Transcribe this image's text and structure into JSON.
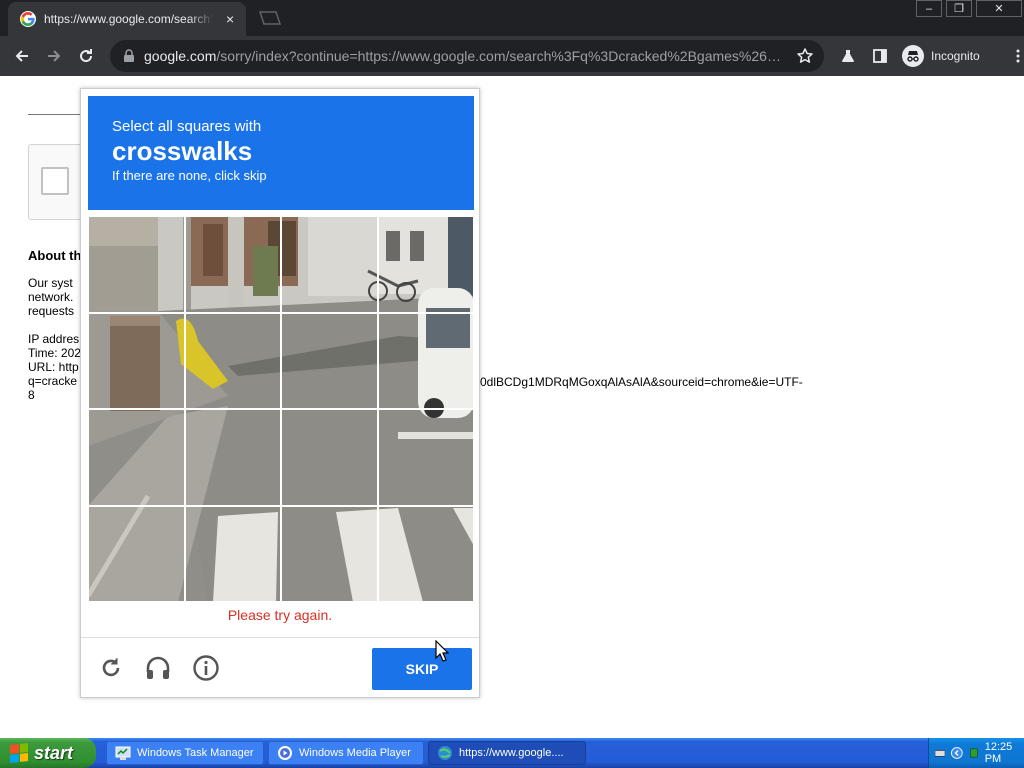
{
  "browser": {
    "tab_title": "https://www.google.com/search?q=",
    "tab_close": "×",
    "url_host": "google.com",
    "url_path": "/sorry/index?continue=https://www.google.com/search%3Fq%3Dcracked%2Bgames%26…",
    "profile_label": "Incognito",
    "window_controls": {
      "minimize": "–",
      "restore": "❐",
      "close": "✕"
    }
  },
  "page": {
    "about_heading": "About th",
    "text_lines": [
      "Our syst",
      "network.",
      "requests",
      "",
      "IP addres",
      "Time: 202",
      "URL: http",
      "q=cracke",
      "8"
    ],
    "right_fragment": "0dlBCDg1MDRqMGoxqAlAsAlA&sourceid=chrome&ie=UTF-"
  },
  "captcha": {
    "instruction": "Select all squares with",
    "target": "crosswalks",
    "hint": "If there are none, click skip",
    "error": "Please try again.",
    "skip_label": "SKIP",
    "icons": [
      "reload-icon",
      "headphones-icon",
      "info-icon"
    ]
  },
  "taskbar": {
    "start_label": "start",
    "tasks": [
      {
        "label": "Windows Task Manager",
        "icon": "task-manager-icon"
      },
      {
        "label": "Windows Media Player",
        "icon": "media-player-icon"
      },
      {
        "label": "https://www.google....",
        "icon": "browser-icon"
      }
    ],
    "clock": "12:25 PM"
  },
  "colors": {
    "accent_blue": "#1a73e8",
    "error_red": "#d93025",
    "chrome_dark": "#35363a",
    "xp_start_green": "#3c9a3c"
  }
}
